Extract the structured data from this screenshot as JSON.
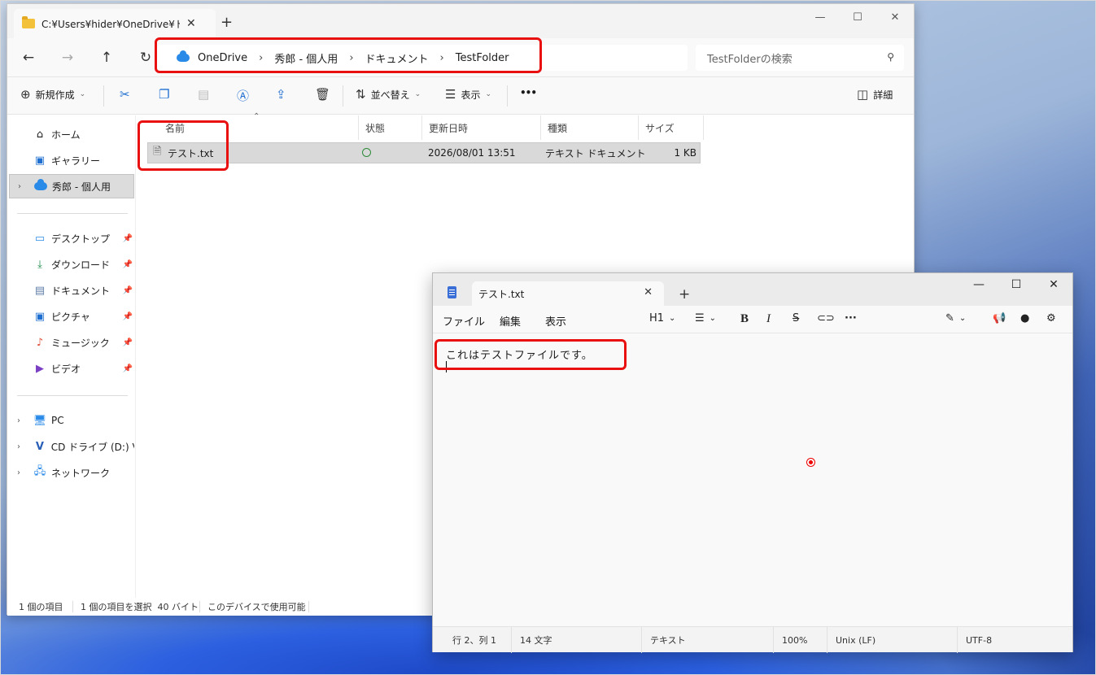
{
  "explorer": {
    "tab_title": "C:¥Users¥hider¥OneDrive¥ドキ",
    "breadcrumb": [
      "OneDrive",
      "秀郎 - 個人用",
      "ドキュメント",
      "TestFolder"
    ],
    "search_placeholder": "TestFolderの検索",
    "toolbar": {
      "new_label": "新規作成",
      "sort_label": "並べ替え",
      "view_label": "表示",
      "more_label": "•••",
      "details_label": "詳細"
    },
    "sidebar": {
      "top": [
        {
          "label": "ホーム",
          "icon": "home-icon"
        },
        {
          "label": "ギャラリー",
          "icon": "gallery-icon"
        },
        {
          "label": "秀郎 - 個人用",
          "icon": "onedrive-icon"
        }
      ],
      "quick": [
        {
          "label": "デスクトップ",
          "icon": "desktop-icon"
        },
        {
          "label": "ダウンロード",
          "icon": "download-icon"
        },
        {
          "label": "ドキュメント",
          "icon": "document-icon"
        },
        {
          "label": "ピクチャ",
          "icon": "picture-icon"
        },
        {
          "label": "ミュージック",
          "icon": "music-icon"
        },
        {
          "label": "ビデオ",
          "icon": "video-icon"
        }
      ],
      "devices": [
        {
          "label": "PC",
          "icon": "pc-icon"
        },
        {
          "label": "CD ドライブ (D:) Virtu",
          "icon": "cd-drive-icon"
        },
        {
          "label": "ネットワーク",
          "icon": "network-icon"
        }
      ]
    },
    "columns": [
      "名前",
      "状態",
      "更新日時",
      "種類",
      "サイズ"
    ],
    "file": {
      "name": "テスト.txt",
      "modified": "2026/08/01 13:51",
      "type": "テキスト ドキュメント",
      "size": "1 KB"
    },
    "status": {
      "count": "1 個の項目",
      "selected": "1 個の項目を選択  40 バイト",
      "availability": "このデバイスで使用可能"
    }
  },
  "notepad": {
    "tab_title": "テスト.txt",
    "menu": [
      "ファイル",
      "編集",
      "表示"
    ],
    "heading_label": "H1",
    "content": "これはテストファイルです。",
    "status": {
      "position": "行 2、列 1",
      "chars": "14 文字",
      "format": "テキスト",
      "zoom": "100%",
      "line_ending": "Unix (LF)",
      "encoding": "UTF-8"
    }
  },
  "colors": {
    "highlight": "#e81010",
    "selection": "#d9d9d9",
    "accent": "#1f6fd1"
  }
}
